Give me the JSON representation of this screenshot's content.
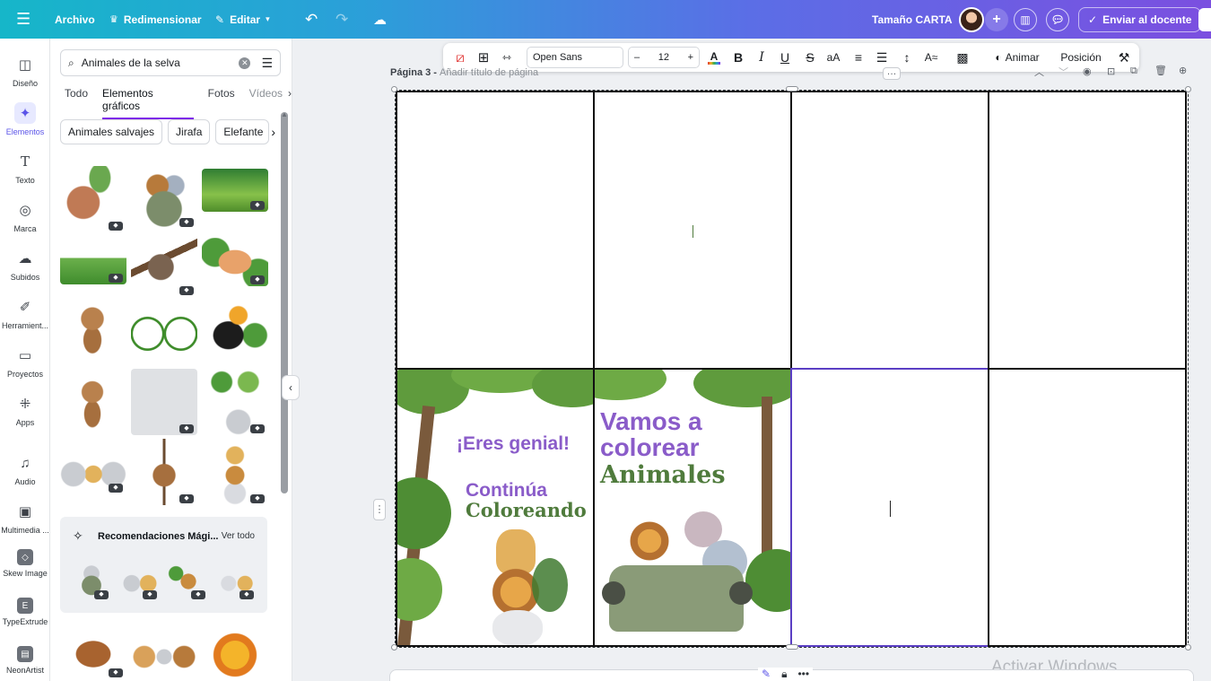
{
  "topbar": {
    "menu_icon": "hamburger-icon",
    "file_label": "Archivo",
    "resize_label": "Redimensionar",
    "edit_label": "Editar",
    "doc_size_label": "Tamaño CARTA",
    "send_label": "Enviar al docente",
    "gradient_start": "#16b6c9",
    "gradient_end": "#7b4fe0"
  },
  "rail": {
    "items": [
      {
        "label": "Diseño",
        "icon": "layout-icon"
      },
      {
        "label": "Elementos",
        "icon": "elements-icon"
      },
      {
        "label": "Texto",
        "icon": "text-icon"
      },
      {
        "label": "Marca",
        "icon": "brand-icon"
      },
      {
        "label": "Subidos",
        "icon": "upload-icon"
      },
      {
        "label": "Herramient...",
        "icon": "tools-icon"
      },
      {
        "label": "Proyectos",
        "icon": "folder-icon"
      },
      {
        "label": "Apps",
        "icon": "apps-icon"
      },
      {
        "label": "Audio",
        "icon": "music-icon"
      },
      {
        "label": "Multimedia ...",
        "icon": "multimedia-icon"
      },
      {
        "label": "Skew Image",
        "icon": "skew-icon"
      },
      {
        "label": "TypeExtrude",
        "icon": "typeextrude-icon"
      },
      {
        "label": "NeonArtist",
        "icon": "neonartist-icon"
      }
    ]
  },
  "panel": {
    "search_value": "Animales de la selva",
    "tabs": [
      "Todo",
      "Elementos gráficos",
      "Fotos",
      "Vídeos"
    ],
    "active_tab": "Elementos gráficos",
    "chips": [
      "Animales salvajes",
      "Jirafa",
      "Elefante"
    ],
    "reco_title": "Recomendaciones Mági...",
    "reco_more": "Ver todo"
  },
  "toolbar": {
    "font": "Open Sans",
    "size": "12",
    "animate_label": "Animar",
    "position_label": "Posición",
    "text_color": "#7d2ae8"
  },
  "canvas": {
    "page_label": "Página 3 - ",
    "page_sub": "Añadir título de página",
    "card1": {
      "headline": "¡Eres genial!",
      "line1": "Continúa",
      "line2": "Coloreando"
    },
    "card2": {
      "line1": "Vamos a",
      "line2": "colorear",
      "line3": "Animales"
    },
    "purple": "#8a5cc9",
    "green": "#4f7b3c"
  },
  "watermark": "Activar Windows"
}
